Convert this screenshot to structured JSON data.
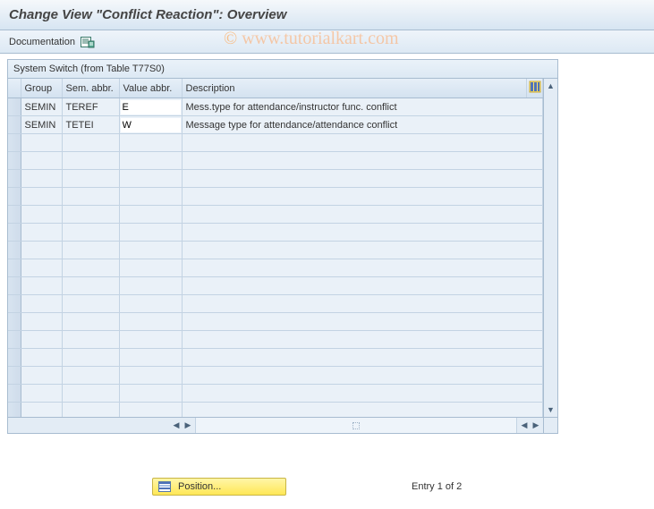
{
  "title": "Change View \"Conflict Reaction\": Overview",
  "toolbar": {
    "documentation_label": "Documentation"
  },
  "watermark": {
    "copy": "©",
    "text": "www.tutorialkart.com"
  },
  "table": {
    "title": "System Switch (from Table T77S0)",
    "columns": {
      "group": "Group",
      "sem": "Sem. abbr.",
      "value": "Value abbr.",
      "desc": "Description"
    },
    "rows": [
      {
        "group": "SEMIN",
        "sem": "TEREF",
        "value": "E",
        "desc": "Mess.type for attendance/instructor func. conflict"
      },
      {
        "group": "SEMIN",
        "sem": "TETEI",
        "value": "W",
        "desc": "Message type for attendance/attendance conflict"
      }
    ]
  },
  "footer": {
    "position_label": "Position...",
    "entry_text": "Entry 1 of 2"
  }
}
